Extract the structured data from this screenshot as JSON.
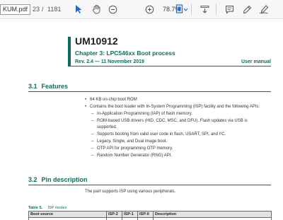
{
  "toolbar": {
    "tab_label": "KUM.pdf",
    "page_current": "23",
    "page_separator": "/",
    "page_total": "1181",
    "zoom": "78.7%",
    "icons": [
      "select-arrow-icon",
      "hand-pan-icon",
      "zoom-out-icon",
      "zoom-in-icon",
      "fit-page-icon",
      "download-icon",
      "comment-icon",
      "highlight-pen-icon",
      "sign-icon"
    ],
    "accent_color": "#1a6fd6"
  },
  "document": {
    "doc_id": "UM10912",
    "chapter": "Chapter 3: LPC546xx Boot process",
    "revision": "Rev. 2.4 — 11 November 2019",
    "manual_type": "User manual",
    "accent_color": "#0d6e5b",
    "sections": [
      {
        "number": "3.1",
        "title": "Features"
      },
      {
        "number": "3.2",
        "title": "Pin description"
      }
    ],
    "features": {
      "bullet_1": "64 KB on-chip boot ROM",
      "bullet_2": "Contains the boot loader with In-System Programming (ISP) facility and the following APIs:",
      "sub_items": [
        "In-Application Programming (IAP) of flash memory.",
        "ROM-based USB drivers (HID, CDC, MSC, and DFU). Flash updates via USB is supported.",
        "Supports booting from valid user code in flash, USART, SPI, and I²C.",
        "Legacy, Single, and Dual image boot.",
        "OTP API for programming OTP memory.",
        "Random Number Generator (RNG) API."
      ]
    },
    "pin_description_text": "The part supports ISP using various peripherals.",
    "table": {
      "caption_number": "Table 5.",
      "caption_title": "ISP modes",
      "headers": [
        "Boot source",
        "ISP-2",
        "ISP-1",
        "ISP-0",
        "Description"
      ]
    }
  }
}
